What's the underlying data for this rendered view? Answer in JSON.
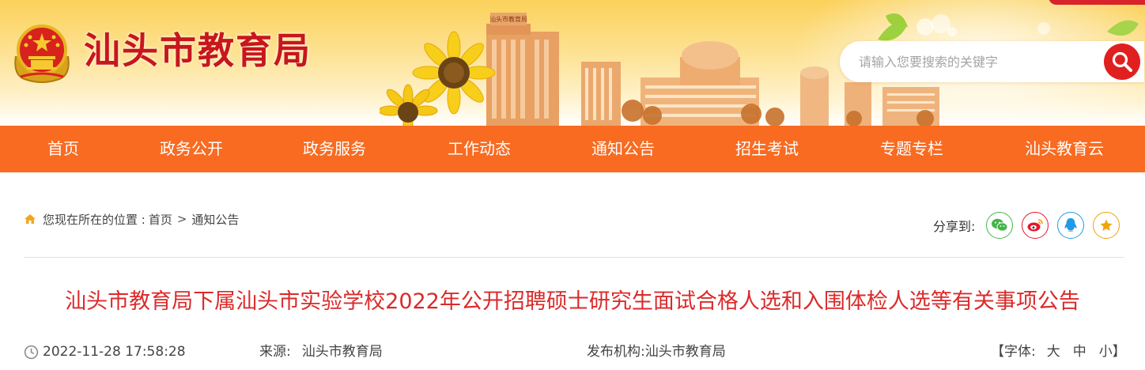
{
  "header": {
    "site_title": "汕头市教育局",
    "building_sign": "汕头市教育局",
    "search": {
      "placeholder": "请输入您要搜索的关键字",
      "value": ""
    }
  },
  "nav": {
    "items": [
      {
        "label": "首页"
      },
      {
        "label": "政务公开"
      },
      {
        "label": "政务服务"
      },
      {
        "label": "工作动态"
      },
      {
        "label": "通知公告"
      },
      {
        "label": "招生考试"
      },
      {
        "label": "专题专栏"
      },
      {
        "label": "汕头教育云"
      }
    ]
  },
  "breadcrumb": {
    "prefix": "您现在所在的位置 :",
    "items": [
      "首页",
      "通知公告"
    ],
    "separator": ">"
  },
  "share": {
    "label": "分享到:",
    "buttons": [
      {
        "name": "wechat",
        "color": "#44b549"
      },
      {
        "name": "weibo",
        "color": "#e6162d"
      },
      {
        "name": "qq",
        "color": "#1e9be8"
      },
      {
        "name": "favorite",
        "color": "#f0a30a"
      }
    ]
  },
  "article": {
    "title": "汕头市教育局下属汕头市实验学校2022年公开招聘硕士研究生面试合格人选和入围体检人选等有关事项公告",
    "datetime": "2022-11-28 17:58:28",
    "source_label": "来源:",
    "source": "汕头市教育局",
    "org_label": "发布机构:",
    "org": "汕头市教育局",
    "font_size": {
      "open": "【字体:",
      "large": "大",
      "medium": "中",
      "small": "小",
      "close": "】"
    }
  },
  "colors": {
    "nav_bg": "#f86b21",
    "title_red": "#db2a2a",
    "brand_red": "#c8161d",
    "search_btn": "#e0201f"
  }
}
